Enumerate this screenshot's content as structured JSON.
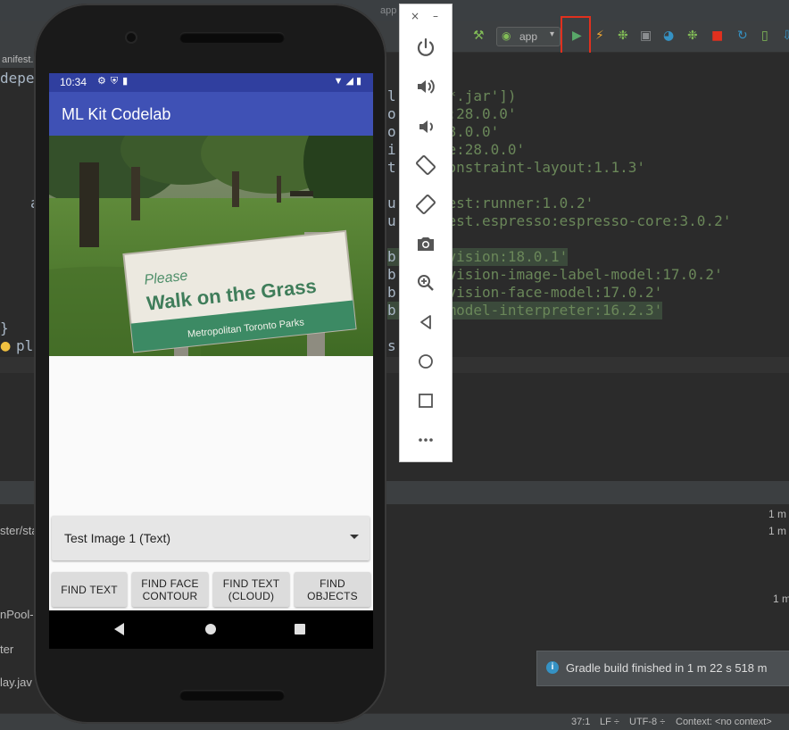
{
  "ide": {
    "window_title_fragment": "app",
    "run_config": "app",
    "file_tab": "anifest.",
    "code_left": [
      "depe",
      "a",
      "}",
      "ply"
    ],
    "code_lines": [
      {
        "pre": "l",
        "str": "'*.jar'])",
        "highlight": false
      },
      {
        "pre": "o",
        "str": "7:28.0.0'",
        "highlight": false
      },
      {
        "pre": "o",
        "str": "28.0.0'",
        "highlight": false
      },
      {
        "pre": "i",
        "str": "ce:28.0.0'",
        "highlight": false
      },
      {
        "pre": "t",
        "str": "constraint-layout:1.1.3'",
        "highlight": false
      },
      {
        "pre": "u",
        "str": "test:runner:1.0.2'",
        "highlight": false
      },
      {
        "pre": "u",
        "str": "test.espresso:espresso-core:3.0.2'",
        "highlight": false
      },
      {
        "pre": "b",
        "str": "-vision:18.0.1'",
        "highlight": true
      },
      {
        "pre": "b",
        "str": "-vision-image-label-model:17.0.2'",
        "highlight": false
      },
      {
        "pre": "b",
        "str": "-vision-face-model:17.0.2'",
        "highlight": false
      },
      {
        "pre": "b",
        "str": "-model-interpreter:16.2.3'",
        "highlight": true
      },
      {
        "pre": "s",
        "str": "",
        "highlight": false
      }
    ],
    "bottom_left": [
      "ster/sta",
      "nPool-",
      "ter",
      "lay.jav"
    ],
    "bottom_right": [
      "1 m",
      "1 m",
      "1 m"
    ],
    "notification": "Gradle build finished in 1 m 22 s 518 m",
    "status": {
      "position": "37:1",
      "line_sep": "LF ÷",
      "encoding": "UTF-8 ÷",
      "context": "Context: <no context>"
    }
  },
  "emulator_panel": {
    "close": "×",
    "minimize": "–",
    "buttons": [
      "power-icon",
      "volume-up-icon",
      "volume-down-icon",
      "rotate-left-icon",
      "rotate-right-icon",
      "camera-icon",
      "zoom-icon",
      "back-icon",
      "home-icon",
      "overview-icon",
      "more-icon"
    ]
  },
  "phone": {
    "status_time": "10:34",
    "app_title": "ML Kit Codelab",
    "sign": {
      "line1": "Please",
      "line2": "Walk on the Grass",
      "line3": "Metropolitan Toronto Parks"
    },
    "spinner_value": "Test Image 1 (Text)",
    "buttons": [
      {
        "line1": "FIND TEXT",
        "line2": ""
      },
      {
        "line1": "FIND FACE",
        "line2": "CONTOUR"
      },
      {
        "line1": "FIND TEXT",
        "line2": "(CLOUD)"
      },
      {
        "line1": "FIND",
        "line2": "OBJECTS"
      }
    ]
  },
  "colors": {
    "primary": "#3f51b5",
    "primary_dark": "#303f9f",
    "run_highlight": "#e0301e"
  }
}
